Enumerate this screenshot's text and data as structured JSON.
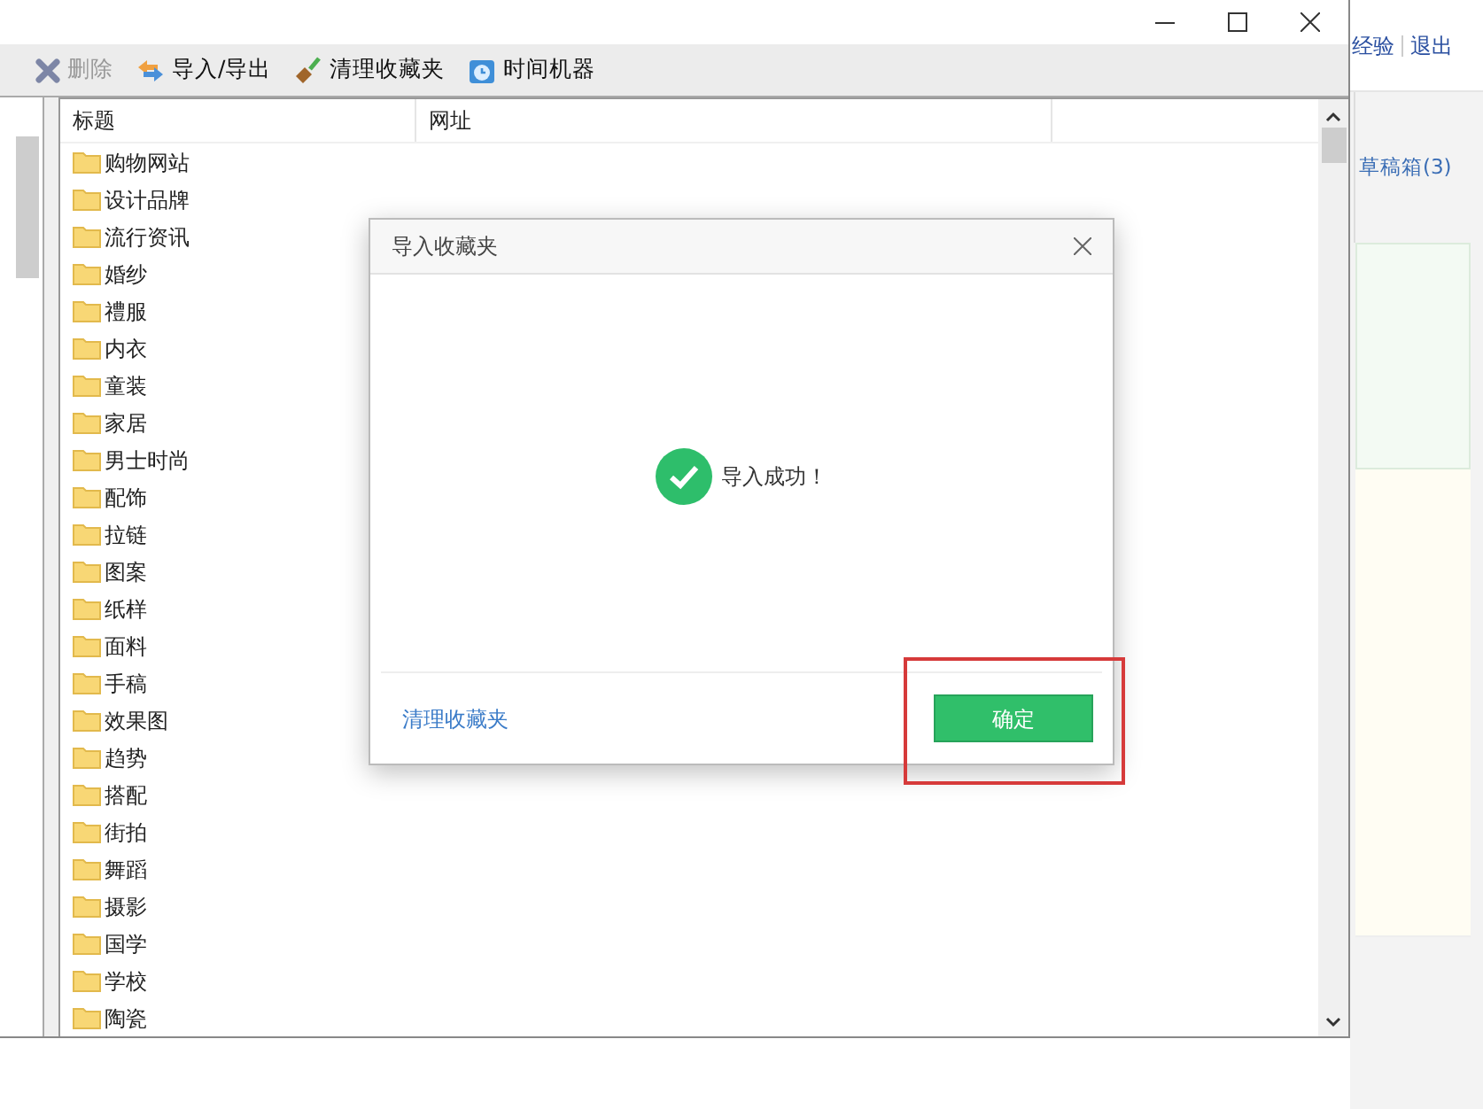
{
  "background_page": {
    "top_links": [
      "经验",
      "退出"
    ],
    "tab": "草稿箱(3)"
  },
  "window": {
    "toolbar": [
      {
        "kind": "delete",
        "label": "删除",
        "disabled": true
      },
      {
        "kind": "import",
        "label": "导入/导出",
        "disabled": false
      },
      {
        "kind": "broom",
        "label": "清理收藏夹",
        "disabled": false
      },
      {
        "kind": "clock",
        "label": "时间机器",
        "disabled": false
      }
    ],
    "table": {
      "columns": [
        "标题",
        "网址"
      ],
      "rows": [
        {
          "title": "购物网站"
        },
        {
          "title": "设计品牌"
        },
        {
          "title": "流行资讯"
        },
        {
          "title": "婚纱"
        },
        {
          "title": "禮服"
        },
        {
          "title": "内衣"
        },
        {
          "title": "童装"
        },
        {
          "title": "家居"
        },
        {
          "title": "男士时尚"
        },
        {
          "title": "配饰"
        },
        {
          "title": "拉链"
        },
        {
          "title": "图案"
        },
        {
          "title": "纸样"
        },
        {
          "title": "面料"
        },
        {
          "title": "手稿"
        },
        {
          "title": "效果图"
        },
        {
          "title": "趋势"
        },
        {
          "title": "搭配"
        },
        {
          "title": "街拍"
        },
        {
          "title": "舞蹈"
        },
        {
          "title": "摄影"
        },
        {
          "title": "国学"
        },
        {
          "title": "学校"
        },
        {
          "title": "陶瓷"
        }
      ]
    }
  },
  "dialog": {
    "title": "导入收藏夹",
    "message": "导入成功！",
    "link": "清理收藏夹",
    "button": "确定"
  }
}
